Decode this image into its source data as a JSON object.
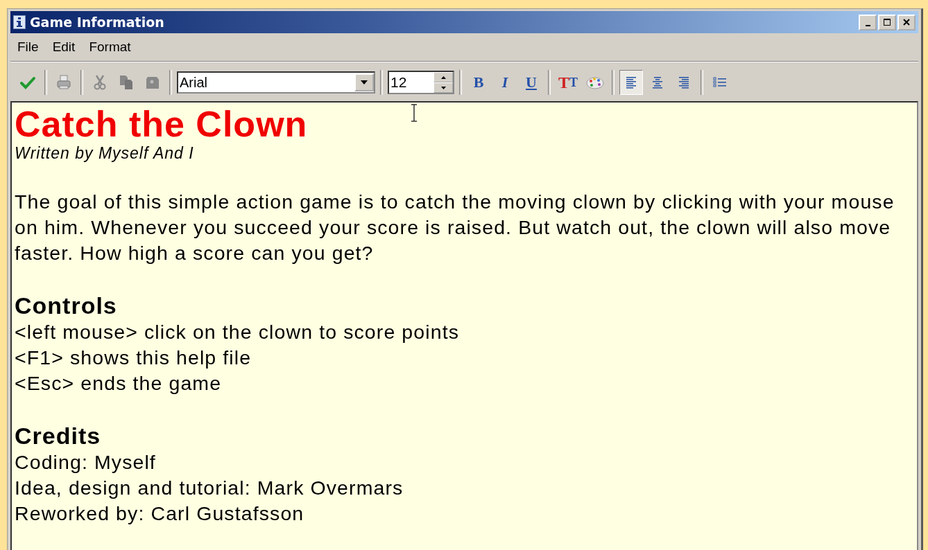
{
  "window": {
    "title": "Game Information"
  },
  "menu": [
    {
      "label": "File"
    },
    {
      "label": "Edit"
    },
    {
      "label": "Format"
    }
  ],
  "toolbar": [
    {
      "kind": "ok"
    },
    {
      "kind": "sep"
    },
    {
      "kind": "print"
    },
    {
      "kind": "sep"
    },
    {
      "kind": "cut"
    },
    {
      "kind": "copy"
    },
    {
      "kind": "paste"
    },
    {
      "kind": "sep"
    },
    {
      "kind": "font",
      "value": "Arial"
    },
    {
      "kind": "sep"
    },
    {
      "kind": "size",
      "value": "12"
    },
    {
      "kind": "sep"
    },
    {
      "kind": "bold",
      "text": "B"
    },
    {
      "kind": "italic",
      "text": "I"
    },
    {
      "kind": "underline",
      "text": "U"
    },
    {
      "kind": "sep"
    },
    {
      "kind": "fontcolor",
      "text": "TT"
    },
    {
      "kind": "palette"
    },
    {
      "kind": "sep"
    },
    {
      "kind": "align-left",
      "selected": true
    },
    {
      "kind": "align-center",
      "selected": false
    },
    {
      "kind": "align-right",
      "selected": false
    },
    {
      "kind": "sep"
    },
    {
      "kind": "bullets"
    }
  ],
  "document": [
    {
      "kind": "title",
      "text": "Catch the Clown"
    },
    {
      "kind": "byline",
      "text": "Written by Myself And I"
    },
    {
      "kind": "blank"
    },
    {
      "kind": "body",
      "text": "The goal of this simple action game is to catch the moving clown by clicking with your mouse on him. Whenever you succeed your score is raised. But watch out, the clown will also move faster. How high a score can you get?"
    },
    {
      "kind": "blank"
    },
    {
      "kind": "heading",
      "text": "Controls"
    },
    {
      "kind": "body",
      "text": "<left mouse> click on the clown to score points"
    },
    {
      "kind": "body",
      "text": "<F1> shows this help file"
    },
    {
      "kind": "body",
      "text": "<Esc> ends the game"
    },
    {
      "kind": "blank"
    },
    {
      "kind": "heading",
      "text": "Credits"
    },
    {
      "kind": "body",
      "text": "Coding: Myself"
    },
    {
      "kind": "body",
      "text": "Idea, design and tutorial: Mark Overmars"
    },
    {
      "kind": "body",
      "text": "Reworked by: Carl Gustafsson"
    }
  ]
}
